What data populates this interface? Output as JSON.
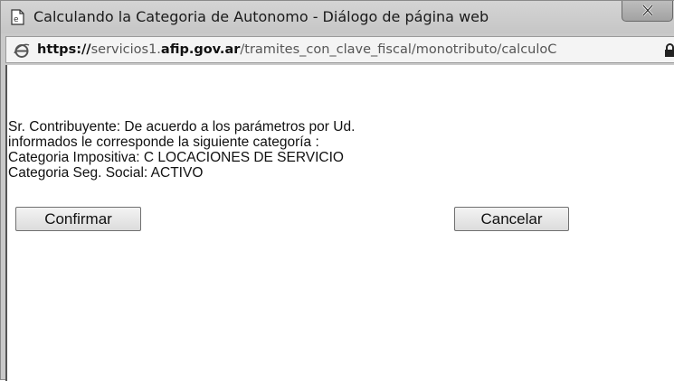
{
  "window": {
    "title": "Calculando la Categoria de Autonomo - Diálogo de página web",
    "title_icon": "ie-page-icon",
    "close_glyph": "X"
  },
  "address": {
    "scheme": "https://",
    "host_prefix": "servicios1.",
    "host_domain": "afip.gov.ar",
    "path": "/tramites_con_clave_fiscal/monotributo/calculoC"
  },
  "message": {
    "lines": [
      "Sr. Contribuyente: De acuerdo a los parámetros por Ud.",
      "informados le corresponde la siguiente categoría :",
      "Categoria Impositiva: C LOCACIONES DE SERVICIO",
      "Categoria Seg. Social: ACTIVO"
    ]
  },
  "buttons": {
    "confirm": "Confirmar",
    "cancel": "Cancelar"
  }
}
